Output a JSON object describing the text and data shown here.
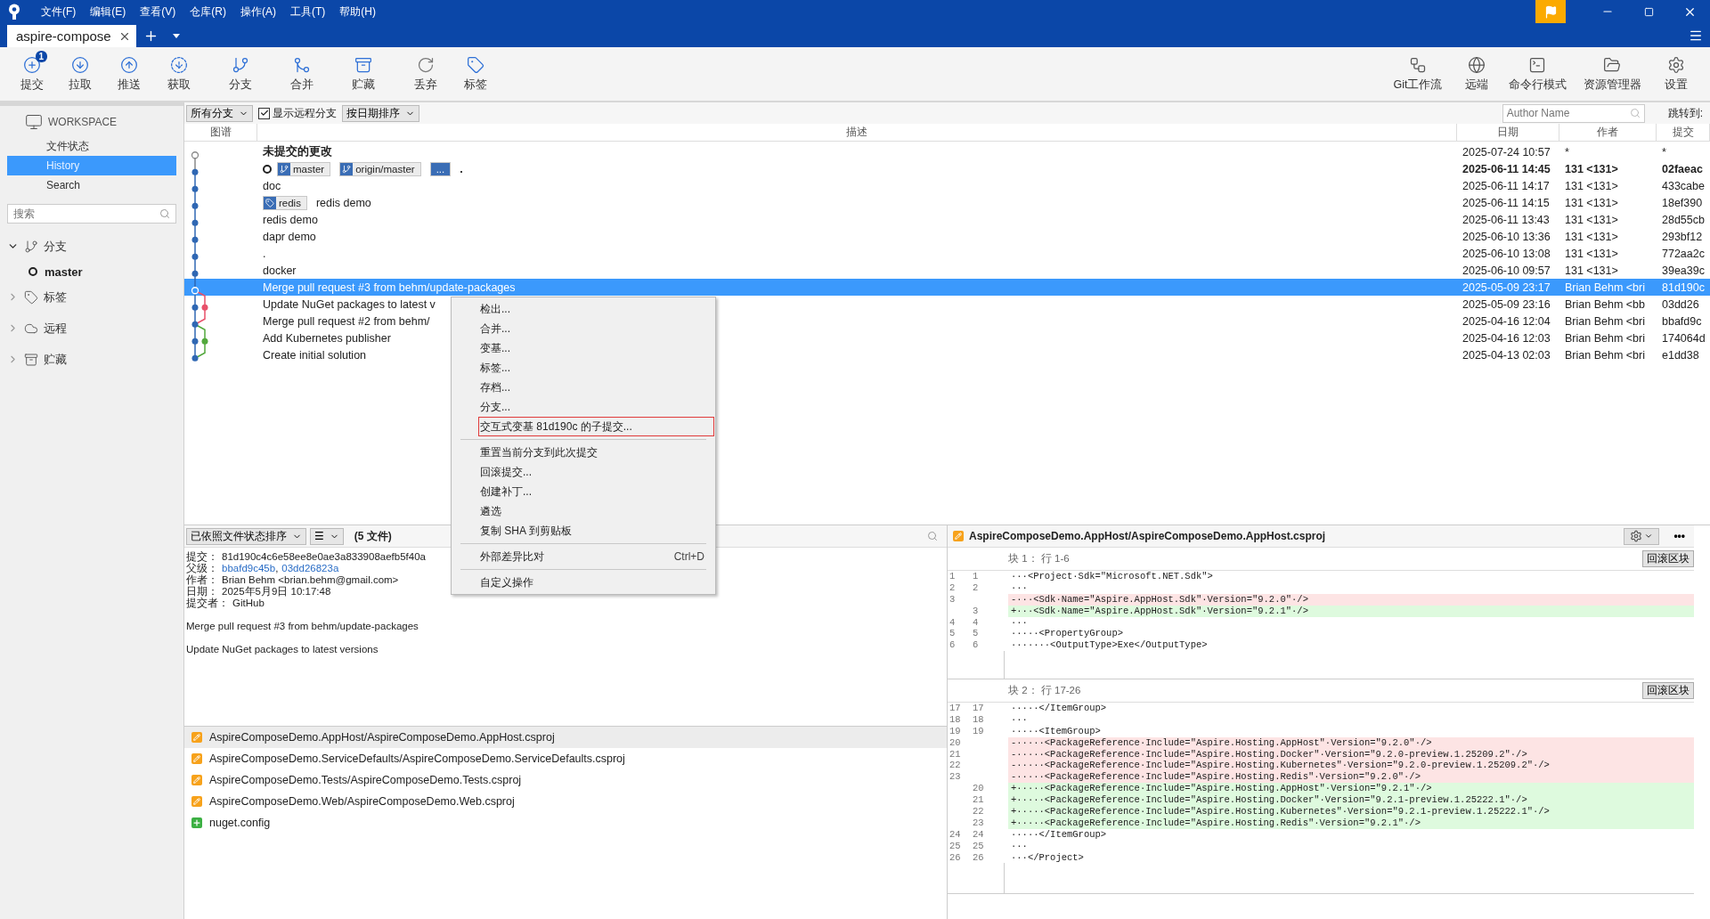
{
  "menu_bar": [
    "文件(F)",
    "编辑(E)",
    "查看(V)",
    "仓库(R)",
    "操作(A)",
    "工具(T)",
    "帮助(H)"
  ],
  "tabs": [
    {
      "label": "aspire-compose",
      "selected": true
    }
  ],
  "toolbar_left": [
    {
      "label": "提交",
      "kind": "commit",
      "badge": "1"
    },
    {
      "label": "拉取",
      "kind": "pull"
    },
    {
      "label": "推送",
      "kind": "push"
    },
    {
      "label": "获取",
      "kind": "fetch"
    },
    {
      "label": "分支",
      "kind": "branch"
    },
    {
      "label": "合并",
      "kind": "merge"
    },
    {
      "label": "贮藏",
      "kind": "stash"
    },
    {
      "label": "丢弃",
      "kind": "discard"
    },
    {
      "label": "标签",
      "kind": "tag"
    }
  ],
  "toolbar_right": [
    {
      "label": "Git工作流",
      "kind": "flow"
    },
    {
      "label": "远端",
      "kind": "remote"
    },
    {
      "label": "命令行模式",
      "kind": "terminal"
    },
    {
      "label": "资源管理器",
      "kind": "explorer"
    },
    {
      "label": "设置",
      "kind": "settings"
    }
  ],
  "sidebar": {
    "workspace": "WORKSPACE",
    "items": [
      {
        "label": "文件状态",
        "selected": false
      },
      {
        "label": "History",
        "selected": true
      },
      {
        "label": "Search",
        "selected": false
      }
    ],
    "search": {
      "placeholder": "搜索"
    },
    "tree": [
      {
        "label": "分支",
        "kind": "branch",
        "expanded": true,
        "children": [
          {
            "label": "master",
            "current": true
          }
        ]
      },
      {
        "label": "标签",
        "kind": "tag",
        "expanded": false
      },
      {
        "label": "远程",
        "kind": "remote",
        "expanded": false
      },
      {
        "label": "贮藏",
        "kind": "stash",
        "expanded": false
      }
    ]
  },
  "filter_bar": {
    "branches": "所有分支",
    "show_remote": {
      "label": "显示远程分支",
      "checked": true
    },
    "sort": "按日期排序",
    "author_search": {
      "placeholder": "Author Name"
    },
    "jump_to": "跳转到:"
  },
  "columns": [
    "图谱",
    "描述",
    "日期",
    "作者",
    "提交"
  ],
  "commits": [
    {
      "kind": "uncommitted",
      "current": false,
      "selected": false,
      "description": "未提交的更改",
      "date": "2025-07-24 10:57",
      "author": "*",
      "sha": "*"
    },
    {
      "kind": "commit",
      "current": true,
      "selected": false,
      "refs": [
        {
          "kind": "branch",
          "label": "master"
        },
        {
          "kind": "branch",
          "label": "origin/master"
        },
        {
          "kind": "more",
          "label": "..."
        }
      ],
      "description": ".",
      "date": "2025-06-11 14:45",
      "author": "131 <131>",
      "sha": "02faeac"
    },
    {
      "kind": "commit",
      "current": false,
      "selected": false,
      "description": "doc",
      "date": "2025-06-11 14:17",
      "author": "131 <131>",
      "sha": "433cabe"
    },
    {
      "kind": "commit",
      "current": false,
      "selected": false,
      "refs": [
        {
          "kind": "tag",
          "label": "redis"
        }
      ],
      "description": "redis demo",
      "date": "2025-06-11 14:15",
      "author": "131 <131>",
      "sha": "18ef390"
    },
    {
      "kind": "commit",
      "current": false,
      "selected": false,
      "description": "redis demo",
      "date": "2025-06-11 13:43",
      "author": "131 <131>",
      "sha": "28d55cb"
    },
    {
      "kind": "commit",
      "current": false,
      "selected": false,
      "description": "dapr demo",
      "date": "2025-06-10 13:36",
      "author": "131 <131>",
      "sha": "293bf12"
    },
    {
      "kind": "commit",
      "current": false,
      "selected": false,
      "description": ".",
      "date": "2025-06-10 13:08",
      "author": "131 <131>",
      "sha": "772aa2c"
    },
    {
      "kind": "commit",
      "current": false,
      "selected": false,
      "description": "docker",
      "date": "2025-06-10 09:57",
      "author": "131 <131>",
      "sha": "39ea39c"
    },
    {
      "kind": "commit",
      "current": false,
      "selected": true,
      "description": "Merge pull request #3 from behm/update-packages",
      "date": "2025-05-09 23:17",
      "author": "Brian Behm <bri",
      "sha": "81d190c"
    },
    {
      "kind": "commit",
      "current": false,
      "selected": false,
      "description": "Update NuGet packages to latest v",
      "date": "2025-05-09 23:16",
      "author": "Brian Behm <bb",
      "sha": "03dd26"
    },
    {
      "kind": "commit",
      "current": false,
      "selected": false,
      "description": "Merge pull request #2 from behm/",
      "date": "2025-04-16 12:04",
      "author": "Brian Behm <bri",
      "sha": "bbafd9c"
    },
    {
      "kind": "commit",
      "current": false,
      "selected": false,
      "description": "Add Kubernetes publisher",
      "date": "2025-04-16 12:03",
      "author": "Brian Behm <bri",
      "sha": "174064d"
    },
    {
      "kind": "commit",
      "current": false,
      "selected": false,
      "description": "Create initial solution",
      "date": "2025-04-13 02:03",
      "author": "Brian Behm <bri",
      "sha": "e1dd38"
    }
  ],
  "context_menu": [
    {
      "kind": "item",
      "label": "检出...",
      "highlighted": false
    },
    {
      "kind": "item",
      "label": "合并...",
      "highlighted": false
    },
    {
      "kind": "item",
      "label": "变基...",
      "highlighted": false
    },
    {
      "kind": "item",
      "label": "标签...",
      "highlighted": false
    },
    {
      "kind": "item",
      "label": "存档...",
      "highlighted": false
    },
    {
      "kind": "item",
      "label": "分支...",
      "highlighted": false
    },
    {
      "kind": "item",
      "label": "交互式变基 81d190c 的子提交...",
      "highlighted": true
    },
    {
      "kind": "separator"
    },
    {
      "kind": "item",
      "label": "重置当前分支到此次提交",
      "highlighted": false
    },
    {
      "kind": "item",
      "label": "回滚提交...",
      "highlighted": false
    },
    {
      "kind": "item",
      "label": "创建补丁...",
      "highlighted": false
    },
    {
      "kind": "item",
      "label": "遴选",
      "highlighted": false
    },
    {
      "kind": "item",
      "label": "复制 SHA 到剪贴板",
      "highlighted": false
    },
    {
      "kind": "separator"
    },
    {
      "kind": "item",
      "label": "外部差异比对",
      "shortcut": "Ctrl+D",
      "highlighted": false
    },
    {
      "kind": "separator"
    },
    {
      "kind": "item",
      "label": "自定义操作",
      "highlighted": false
    }
  ],
  "file_toolbar": {
    "sort": "已依照文件状态排序",
    "view": "☰",
    "count": "(5 文件)"
  },
  "details": {
    "fields": [
      {
        "label": "提交：",
        "value": "81d190c4c6e58ee8e0ae3a833908aefb5f40a"
      },
      {
        "label": "父级：",
        "links": [
          "bbafd9c45b",
          "03dd26823a"
        ],
        "separator": ","
      },
      {
        "label": "作者：",
        "value": "Brian Behm <brian.behm@gmail.com>"
      },
      {
        "label": "日期：",
        "value": "2025年5月9日 10:17:48"
      },
      {
        "label": "提交者：",
        "value": "GitHub"
      }
    ],
    "message": [
      "Merge pull request #3 from behm/update-packages",
      "Update NuGet packages to latest versions"
    ]
  },
  "files": [
    {
      "kind": "modified",
      "path": "AspireComposeDemo.AppHost/AspireComposeDemo.AppHost.csproj",
      "selected": true
    },
    {
      "kind": "modified",
      "path": "AspireComposeDemo.ServiceDefaults/AspireComposeDemo.ServiceDefaults.csproj",
      "selected": false
    },
    {
      "kind": "modified",
      "path": "AspireComposeDemo.Tests/AspireComposeDemo.Tests.csproj",
      "selected": false
    },
    {
      "kind": "modified",
      "path": "AspireComposeDemo.Web/AspireComposeDemo.Web.csproj",
      "selected": false
    },
    {
      "kind": "added",
      "path": "nuget.config",
      "selected": false
    }
  ],
  "diff": {
    "file": "AspireComposeDemo.AppHost/AspireComposeDemo.AppHost.csproj",
    "more": "•••",
    "hunks": [
      {
        "title": "块 1： 行 1-6",
        "button": "回滚区块",
        "lines": [
          {
            "kind": "context",
            "old": "1",
            "new": "1",
            "text": "···<Project·Sdk=\"Microsoft.NET.Sdk\">"
          },
          {
            "kind": "context",
            "old": "2",
            "new": "2",
            "text": "···"
          },
          {
            "kind": "deleted",
            "old": "3",
            "text": "-···<Sdk·Name=\"Aspire.AppHost.Sdk\"·Version=\"9.2.0\"·/>"
          },
          {
            "kind": "added",
            "new": "3",
            "text": "+···<Sdk·Name=\"Aspire.AppHost.Sdk\"·Version=\"9.2.1\"·/>"
          },
          {
            "kind": "context",
            "old": "4",
            "new": "4",
            "text": "···"
          },
          {
            "kind": "context",
            "old": "5",
            "new": "5",
            "text": "·····<PropertyGroup>"
          },
          {
            "kind": "context",
            "old": "6",
            "new": "6",
            "text": "·······<OutputType>Exe</OutputType>"
          }
        ]
      },
      {
        "title": "块 2： 行 17-26",
        "button": "回滚区块",
        "lines": [
          {
            "kind": "context",
            "old": "17",
            "new": "17",
            "text": "·····</ItemGroup>"
          },
          {
            "kind": "context",
            "old": "18",
            "new": "18",
            "text": "···"
          },
          {
            "kind": "context",
            "old": "19",
            "new": "19",
            "text": "·····<ItemGroup>"
          },
          {
            "kind": "deleted",
            "old": "20",
            "text": "-·····<PackageReference·Include=\"Aspire.Hosting.AppHost\"·Version=\"9.2.0\"·/>"
          },
          {
            "kind": "deleted",
            "old": "21",
            "text": "-·····<PackageReference·Include=\"Aspire.Hosting.Docker\"·Version=\"9.2.0-preview.1.25209.2\"·/>"
          },
          {
            "kind": "deleted",
            "old": "22",
            "text": "-·····<PackageReference·Include=\"Aspire.Hosting.Kubernetes\"·Version=\"9.2.0-preview.1.25209.2\"·/>"
          },
          {
            "kind": "deleted",
            "old": "23",
            "text": "-·····<PackageReference·Include=\"Aspire.Hosting.Redis\"·Version=\"9.2.0\"·/>"
          },
          {
            "kind": "added",
            "new": "20",
            "text": "+·····<PackageReference·Include=\"Aspire.Hosting.AppHost\"·Version=\"9.2.1\"·/>"
          },
          {
            "kind": "added",
            "new": "21",
            "text": "+·····<PackageReference·Include=\"Aspire.Hosting.Docker\"·Version=\"9.2.1-preview.1.25222.1\"·/>"
          },
          {
            "kind": "added",
            "new": "22",
            "text": "+·····<PackageReference·Include=\"Aspire.Hosting.Kubernetes\"·Version=\"9.2.1-preview.1.25222.1\"·/>"
          },
          {
            "kind": "added",
            "new": "23",
            "text": "+·····<PackageReference·Include=\"Aspire.Hosting.Redis\"·Version=\"9.2.1\"·/>"
          },
          {
            "kind": "context",
            "old": "24",
            "new": "24",
            "text": "·····</ItemGroup>"
          },
          {
            "kind": "context",
            "old": "25",
            "new": "25",
            "text": "···"
          },
          {
            "kind": "context",
            "old": "26",
            "new": "26",
            "text": "···</Project>"
          }
        ]
      }
    ]
  }
}
